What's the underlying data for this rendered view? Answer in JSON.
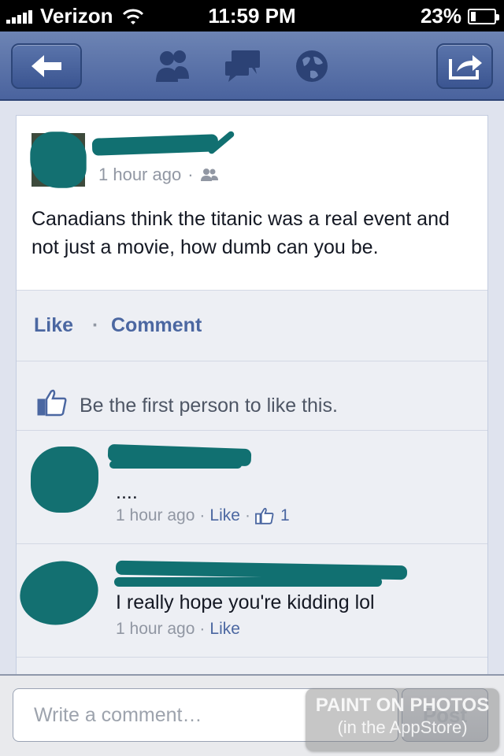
{
  "status_bar": {
    "carrier": "Verizon",
    "time": "11:59 PM",
    "battery_percent": "23%",
    "battery_level": 0.23
  },
  "nav": {
    "back_icon": "back-arrow-icon",
    "icons": [
      "friend-requests-icon",
      "messages-icon",
      "notifications-globe-icon"
    ],
    "share_icon": "share-icon"
  },
  "post": {
    "time": "1 hour ago",
    "separator": "·",
    "text": "Canadians think the titanic was a real event and not just a movie, how dumb can you be."
  },
  "actions": {
    "like": "Like",
    "dot": "·",
    "comment": "Comment"
  },
  "likes": {
    "text": "Be the first person to like this."
  },
  "comments": [
    {
      "text": "....",
      "time": "1 hour ago",
      "like": "Like",
      "like_count": "1",
      "sep": "·"
    },
    {
      "text": "I really hope you're kidding lol",
      "time": "1 hour ago",
      "like": "Like",
      "sep": "·"
    }
  ],
  "composer": {
    "placeholder": "Write a comment…",
    "post_label": "Post"
  },
  "watermark": {
    "line1": "PAINT ON PHOTOS",
    "line2": "(in the AppStore)"
  },
  "colors": {
    "nav": "#4a639e",
    "link": "#4b67a1",
    "scribble": "#117071"
  }
}
